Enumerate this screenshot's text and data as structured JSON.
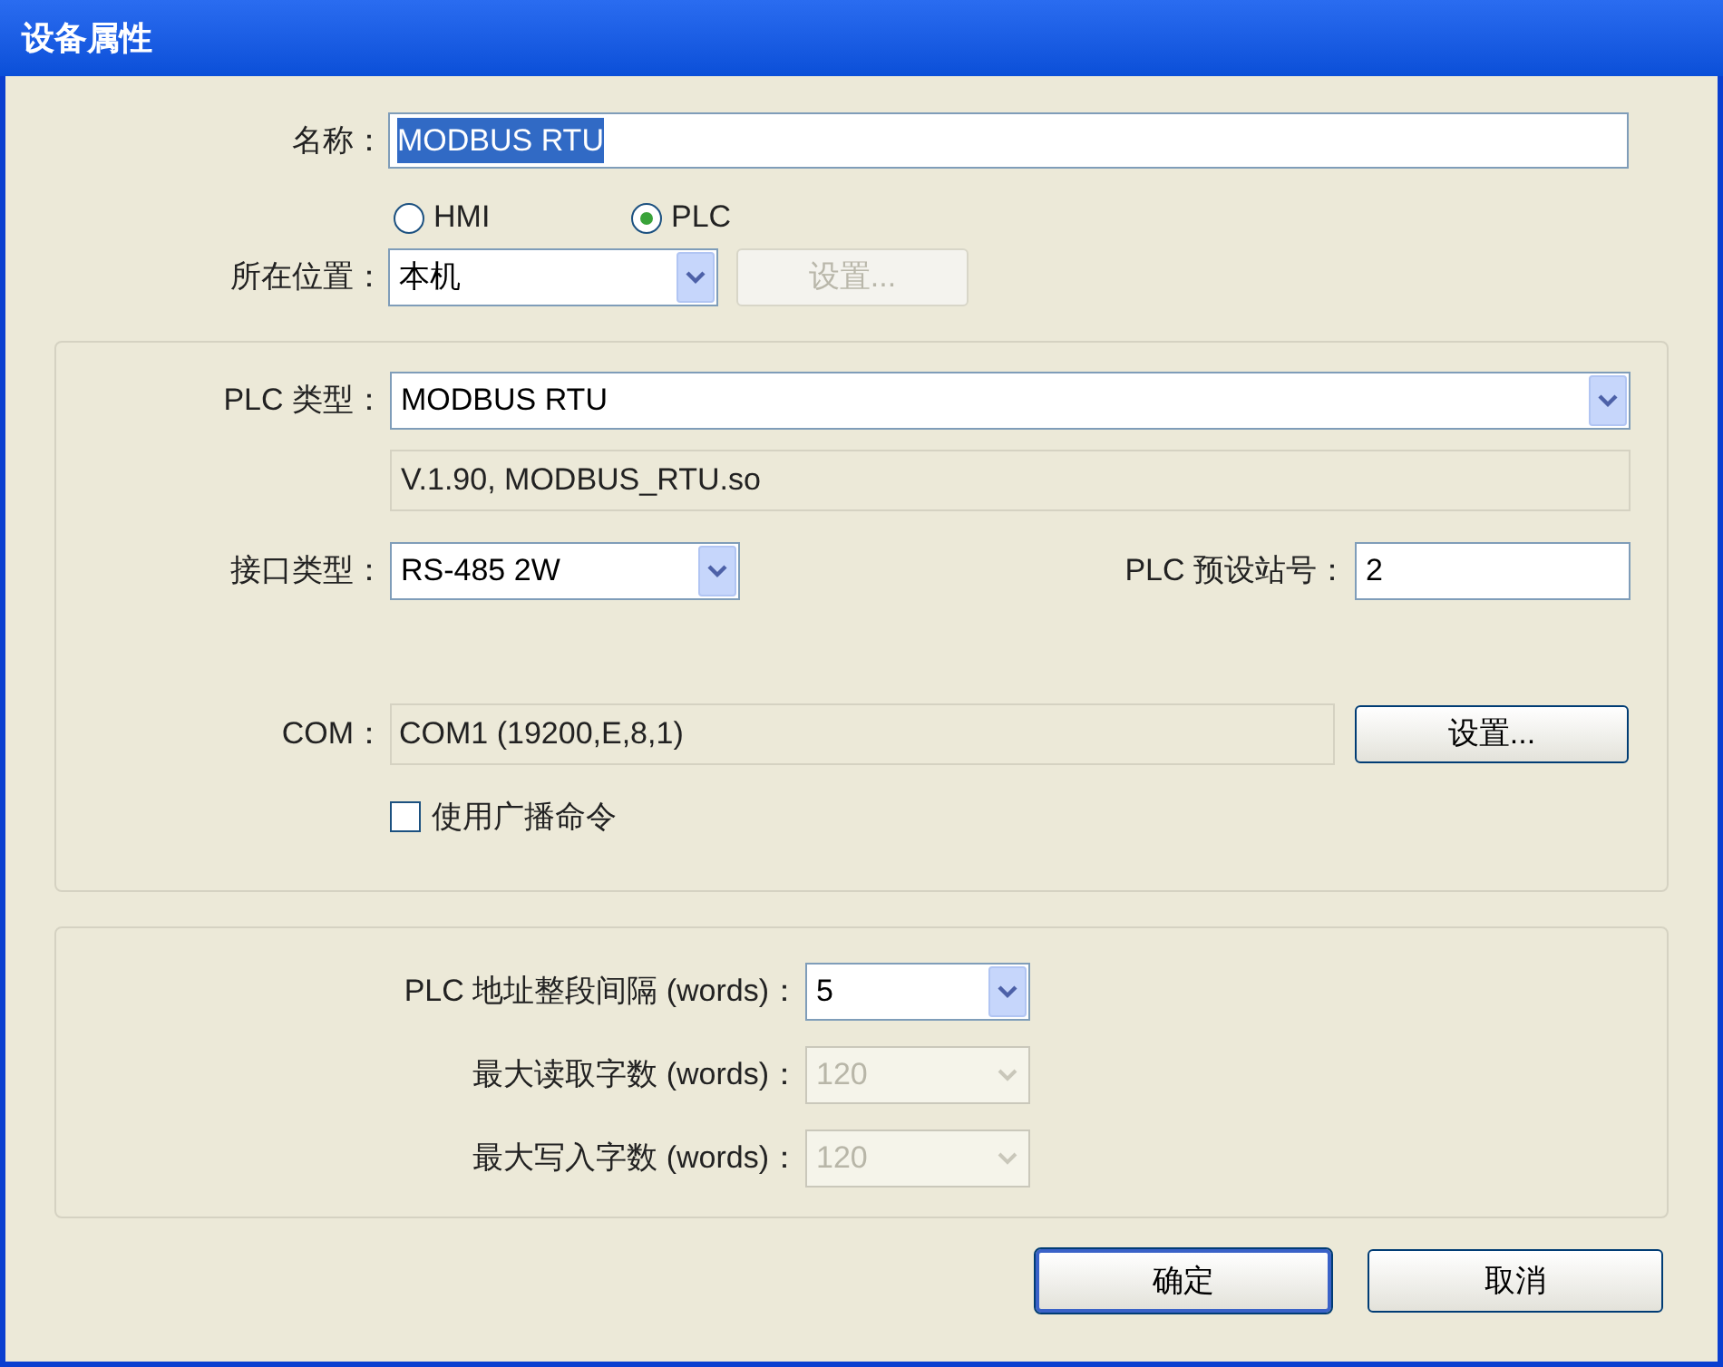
{
  "window": {
    "title": "设备属性"
  },
  "name": {
    "label": "名称：",
    "value": "MODBUS RTU",
    "selected": true
  },
  "device_type": [
    {
      "label": "HMI",
      "selected": false
    },
    {
      "label": "PLC",
      "selected": true
    }
  ],
  "location": {
    "label": "所在位置：",
    "value": "本机",
    "button": {
      "label": "设置...",
      "disabled": true
    }
  },
  "plc_type": {
    "label": "PLC 类型：",
    "value": "MODBUS RTU"
  },
  "driver_info": "V.1.90, MODBUS_RTU.so",
  "interface": {
    "label": "接口类型：",
    "value": "RS-485 2W"
  },
  "station": {
    "label": "PLC 预设站号：",
    "value": "2"
  },
  "com": {
    "label": "COM：",
    "value": "COM1 (19200,E,8,1)",
    "button": {
      "label": "设置...",
      "disabled": false
    }
  },
  "broadcast": {
    "label": "使用广播命令",
    "checked": false
  },
  "address_settings": [
    {
      "label": "PLC 地址整段间隔 (words)：",
      "value": "5",
      "disabled": false
    },
    {
      "label": "最大读取字数 (words)：",
      "value": "120",
      "disabled": true
    },
    {
      "label": "最大写入字数 (words)：",
      "value": "120",
      "disabled": true
    }
  ],
  "buttons": [
    {
      "label": "确定",
      "default": true
    },
    {
      "label": "取消",
      "default": false
    }
  ]
}
